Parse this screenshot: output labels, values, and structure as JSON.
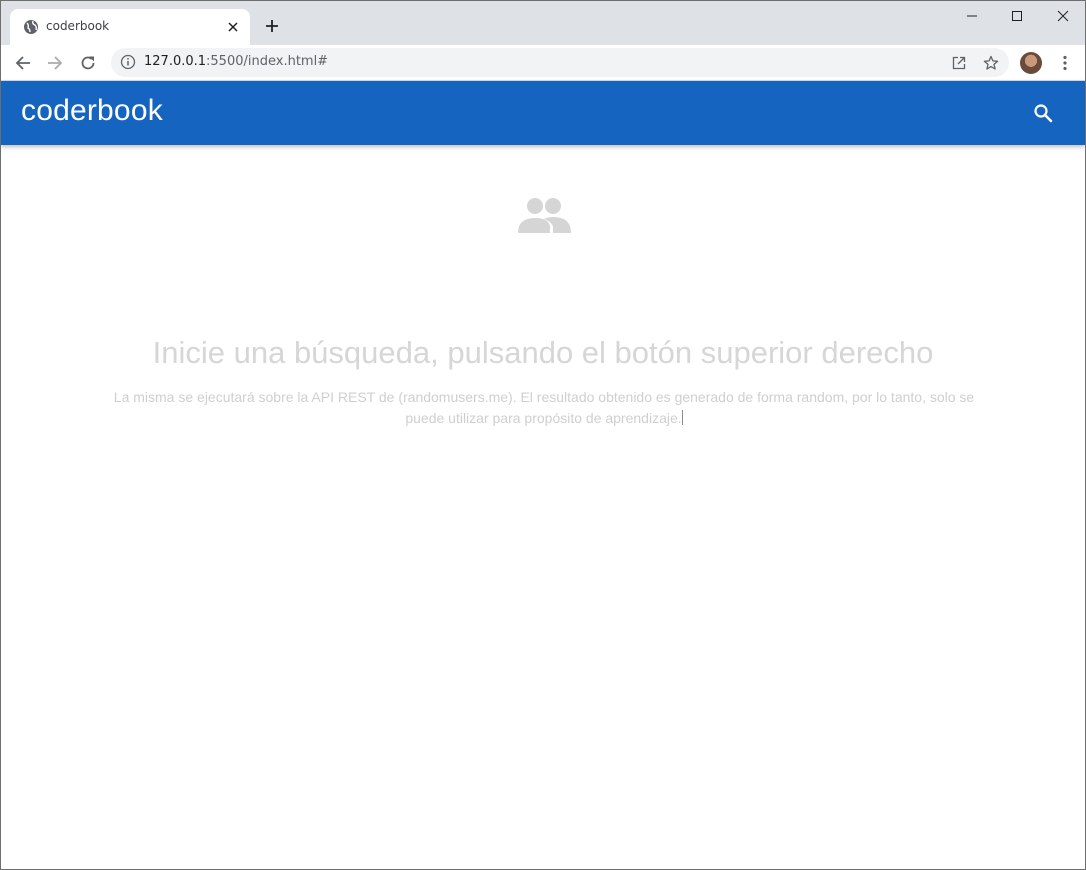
{
  "browser": {
    "tab": {
      "title": "coderbook",
      "favicon": "globe-icon",
      "close": "close-icon"
    },
    "new_tab": "plus-icon",
    "window_controls": [
      "minimize-icon",
      "maximize-icon",
      "close-icon"
    ],
    "toolbar": {
      "back": "back-arrow-icon",
      "forward": "forward-arrow-icon",
      "reload": "reload-icon",
      "site_info": "info-icon",
      "url_host": "127.0.0.1",
      "url_rest": ":5500/index.html#",
      "open_in": "open-external-icon",
      "bookmark": "star-icon",
      "profile": "avatar",
      "menu": "kebab-menu-icon"
    }
  },
  "app": {
    "brand": "coderbook",
    "accent_color": "#1565c0",
    "search_icon": "search-icon",
    "empty_state": {
      "icon": "people-icon",
      "title": "Inicie una búsqueda, pulsando el botón superior derecho",
      "description": "La misma se ejecutará sobre la API REST de (randomusers.me). El resultado obtenido es generado de forma random, por lo tanto, solo se puede utilizar para propósito de aprendizaje."
    }
  }
}
